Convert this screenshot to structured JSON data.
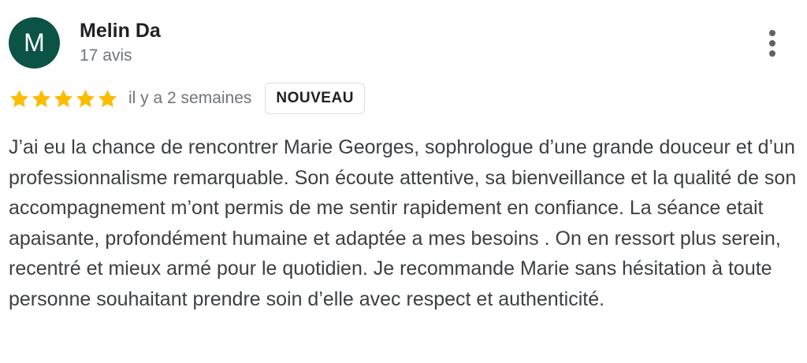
{
  "author": {
    "initial": "M",
    "name": "Melin Da",
    "review_count": "17 avis",
    "avatar_color": "#0b5345"
  },
  "review": {
    "rating": 5,
    "rating_max": 5,
    "star_color": "#fbbc04",
    "date": "il y a 2 semaines",
    "badge": "NOUVEAU",
    "text": "J’ai eu la chance de rencontrer Marie Georges, sophrologue d’une grande douceur et d’un professionnalisme remarquable. Son écoute attentive, sa bienveillance et la qualité de son accompagnement m’ont permis de me sentir rapidement en confiance. La séance etait apaisante, profondément humaine et adaptée a mes besoins . On en ressort plus serein, recentré et mieux armé pour le quotidien. Je recommande Marie sans hésitation à toute personne souhaitant prendre soin d’elle avec respect et authenticité."
  },
  "menu": {
    "icon": "more-vert-icon"
  }
}
